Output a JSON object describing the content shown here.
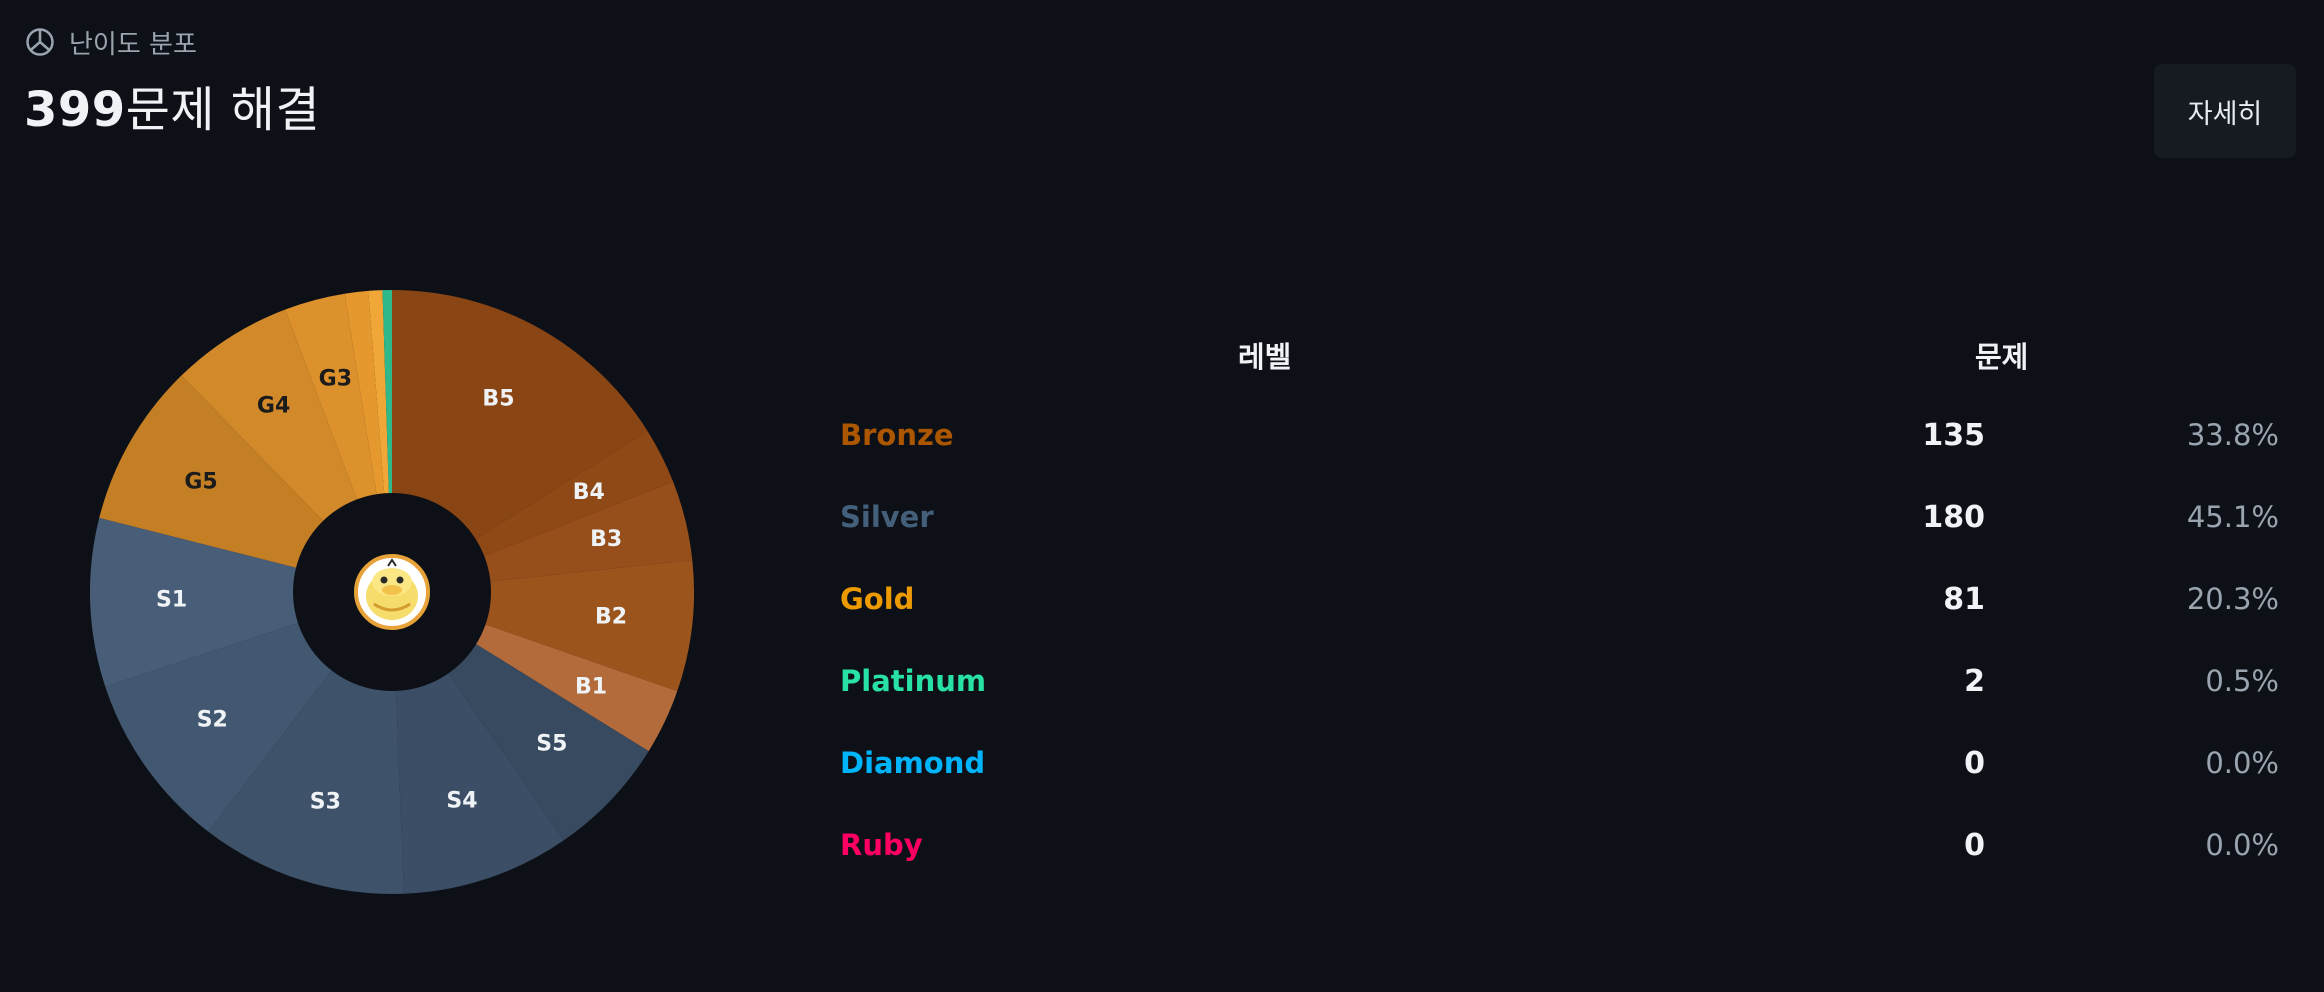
{
  "header": {
    "section_label": "난이도 분포",
    "solved_count": "399",
    "solved_suffix": "문제 해결",
    "detail_button": "자세히"
  },
  "table": {
    "col_level": "레벨",
    "col_problems": "문제",
    "rows": [
      {
        "tier": "Bronze",
        "count": "135",
        "percent": "33.8%",
        "color": "#ad5600"
      },
      {
        "tier": "Silver",
        "count": "180",
        "percent": "45.1%",
        "color": "#435f7a"
      },
      {
        "tier": "Gold",
        "count": "81",
        "percent": "20.3%",
        "color": "#ec9a00"
      },
      {
        "tier": "Platinum",
        "count": "2",
        "percent": "0.5%",
        "color": "#27e2a4"
      },
      {
        "tier": "Diamond",
        "count": "0",
        "percent": "0.0%",
        "color": "#00b4fc"
      },
      {
        "tier": "Ruby",
        "count": "0",
        "percent": "0.0%",
        "color": "#ff0062"
      }
    ]
  },
  "chart_data": {
    "type": "pie",
    "style": "donut",
    "start": "top, clockwise",
    "slices": [
      {
        "label": "B5",
        "value": 64,
        "color": "#8a4515"
      },
      {
        "label": "B4",
        "value": 12,
        "color": "#8f4917"
      },
      {
        "label": "B3",
        "value": 17,
        "color": "#964f1a"
      },
      {
        "label": "B2",
        "value": 28,
        "color": "#9c541d"
      },
      {
        "label": "B1",
        "value": 14,
        "color": "#b36b3c"
      },
      {
        "label": "S5",
        "value": 26,
        "color": "#384a60"
      },
      {
        "label": "S4",
        "value": 36,
        "color": "#3b4e65"
      },
      {
        "label": "S3",
        "value": 44,
        "color": "#3e526a"
      },
      {
        "label": "S2",
        "value": 38,
        "color": "#425770"
      },
      {
        "label": "S1",
        "value": 36,
        "color": "#485e78"
      },
      {
        "label": "G5",
        "value": 35,
        "color": "#c47f24"
      },
      {
        "label": "G4",
        "value": 26,
        "color": "#d1892a"
      },
      {
        "label": "G3",
        "value": 13,
        "color": "#dd912c"
      },
      {
        "label": "",
        "value": 5,
        "color": "#e5982e"
      },
      {
        "label": "",
        "value": 3,
        "color": "#f0a737"
      },
      {
        "label": "",
        "value": 2,
        "color": "#2fb98a"
      }
    ],
    "inner_bg": "#0d1117"
  }
}
